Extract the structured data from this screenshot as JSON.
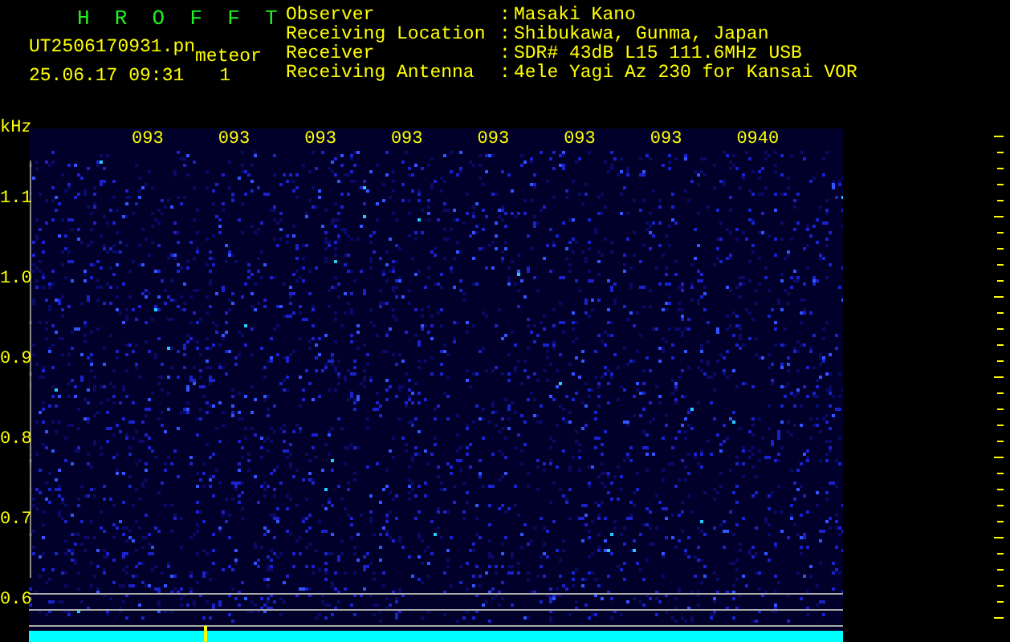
{
  "header": {
    "title": "H R O F F T",
    "file_name": "UT2506170931.pn",
    "event_type": "meteor",
    "timestamp": "25.06.17 09:31",
    "count": "1"
  },
  "station_info": [
    {
      "label": "Observer",
      "separator": ":",
      "value": "Masaki Kano"
    },
    {
      "label": "Receiving Location",
      "separator": ":",
      "value": "Shibukawa, Gunma, Japan"
    },
    {
      "label": "Receiver",
      "separator": ":",
      "value": "SDR# 43dB L15 111.6MHz USB"
    },
    {
      "label": "Receiving Antenna",
      "separator": ":",
      "value": "4ele Yagi Az 230 for Kansai VOR"
    }
  ],
  "spectrogram": {
    "frequency_unit": "kHz",
    "frequency_labels": [
      "1.1",
      "1.0",
      "0.9",
      "0.8",
      "0.7",
      "0.6"
    ],
    "time_labels": [
      "093",
      "093",
      "093",
      "093",
      "093",
      "093",
      "093",
      "0940"
    ]
  }
}
